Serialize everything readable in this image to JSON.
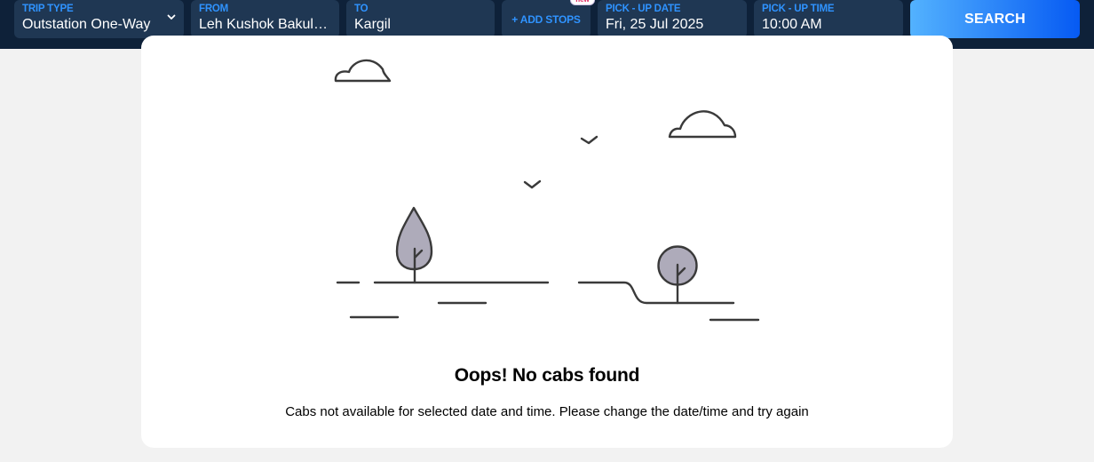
{
  "search_bar": {
    "trip_type": {
      "label": "TRIP TYPE",
      "value": "Outstation One-Way"
    },
    "from": {
      "label": "FROM",
      "value": "Leh Kushok Bakula ..."
    },
    "to": {
      "label": "TO",
      "value": "Kargil"
    },
    "add_stops": {
      "label": "+ ADD STOPS",
      "badge": "new"
    },
    "pickup_date": {
      "label": "PICK - UP DATE",
      "value": "Fri, 25 Jul 2025"
    },
    "pickup_time": {
      "label": "PICK - UP TIME",
      "value": "10:00 AM"
    },
    "search_label": "SEARCH"
  },
  "empty_state": {
    "illustration_icon": "landscape-no-results-illustration",
    "title": "Oops! No cabs found",
    "description": "Cabs not available for selected date and time. Please change the date/time and try again"
  },
  "colors": {
    "top_bar": "#0e2139",
    "field_bg": "#1f3753",
    "field_label": "#2f93ff",
    "search_gradient_start": "#53b2fe",
    "search_gradient_end": "#065af3",
    "page_bg": "#f2f2f2",
    "card_bg": "#ffffff",
    "tree_fill": "#aeabba",
    "line": "#3a3a3a"
  }
}
